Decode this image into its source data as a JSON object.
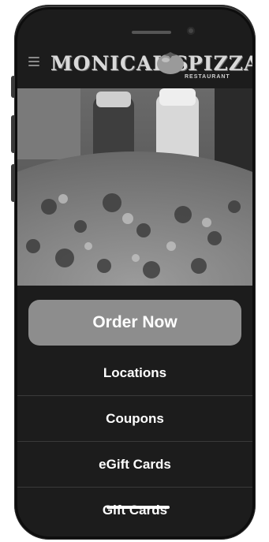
{
  "brand": {
    "name_left": "MONICAL'S",
    "name_right": "PIZZA.",
    "subtitle": "RESTAURANT"
  },
  "icons": {
    "menu": "hamburger-menu-icon",
    "logo_mark": "tomato-icon"
  },
  "actions": {
    "order_label": "Order Now"
  },
  "menu": {
    "items": [
      {
        "label": "Locations"
      },
      {
        "label": "Coupons"
      },
      {
        "label": "eGift Cards"
      },
      {
        "label": "Gift Cards"
      }
    ]
  },
  "colors": {
    "background": "#1c1c1c",
    "button": "#8d8d8d",
    "text": "#ffffff"
  }
}
